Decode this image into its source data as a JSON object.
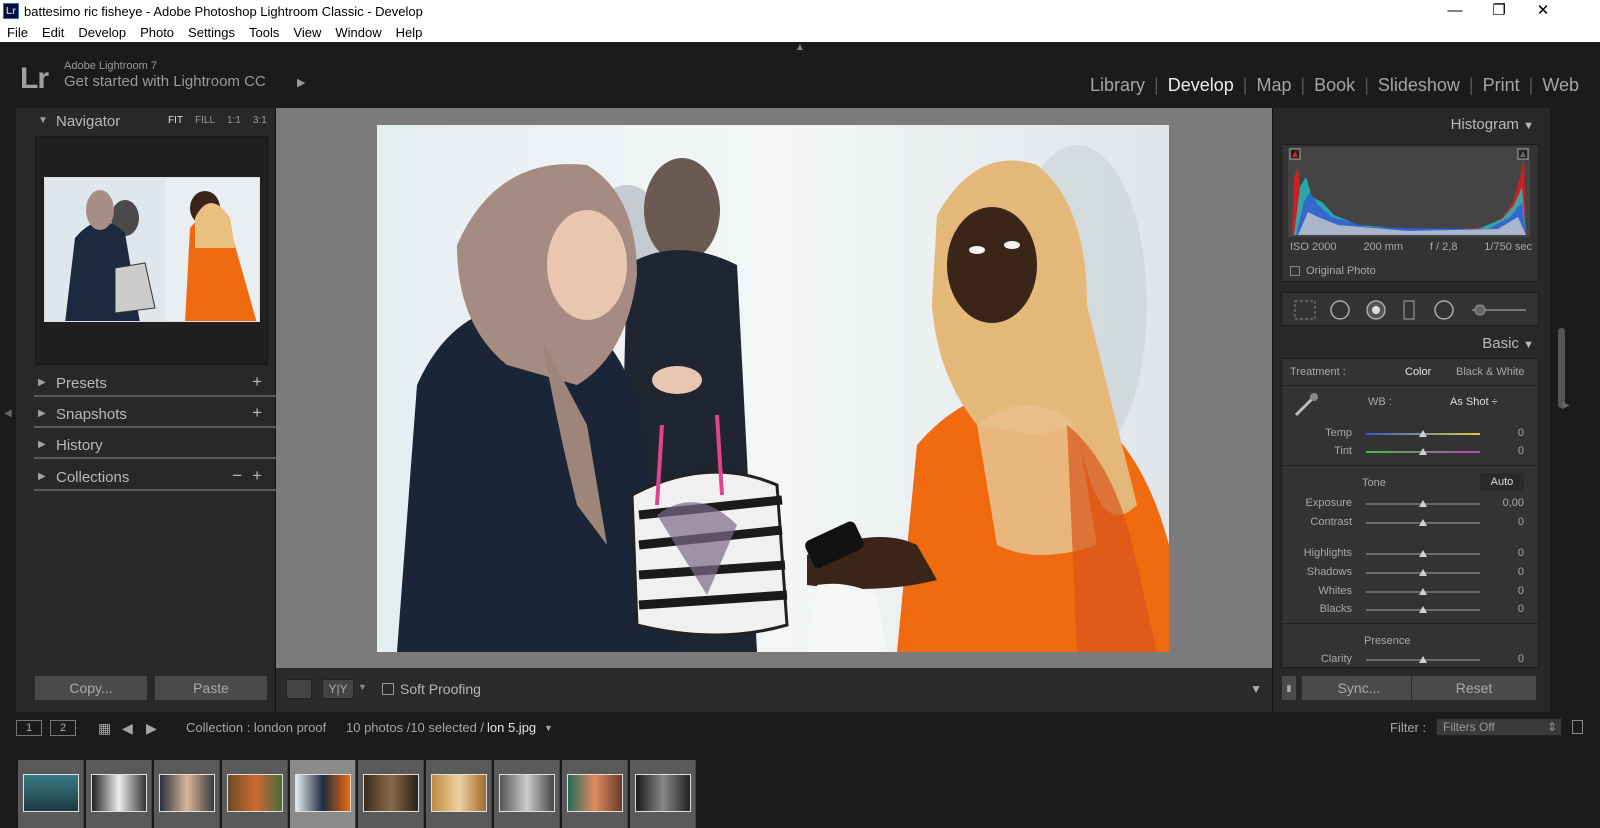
{
  "window": {
    "title": "battesimo ric fisheye - Adobe Photoshop Lightroom Classic - Develop",
    "app_icon": "Lr",
    "minimize": "—",
    "maximize": "❐",
    "close": "✕"
  },
  "menu": [
    "File",
    "Edit",
    "Develop",
    "Photo",
    "Settings",
    "Tools",
    "View",
    "Window",
    "Help"
  ],
  "identity": {
    "logo": "Lr",
    "version": "Adobe Lightroom 7",
    "tagline": "Get started with Lightroom CC",
    "arrow": "▶"
  },
  "modules": [
    "Library",
    "Develop",
    "Map",
    "Book",
    "Slideshow",
    "Print",
    "Web"
  ],
  "active_module": "Develop",
  "left_panel": {
    "navigator": {
      "title": "Navigator",
      "options": [
        "FIT",
        "FILL",
        "1:1",
        "3:1"
      ],
      "active": "FIT"
    },
    "presets": "Presets",
    "snapshots": "Snapshots",
    "history": "History",
    "collections": "Collections",
    "copy_label": "Copy...",
    "paste_label": "Paste"
  },
  "toolbar": {
    "soft_proofing": "Soft Proofing",
    "yy": "Y|Y"
  },
  "right_panel": {
    "histogram_title": "Histogram",
    "iso": "ISO 2000",
    "focal": "200 mm",
    "aperture": "f / 2,8",
    "shutter": "1/750 sec",
    "original_photo": "Original Photo",
    "basic_title": "Basic",
    "treatment_label": "Treatment :",
    "treatment_color": "Color",
    "treatment_bw": "Black & White",
    "wb_label": "WB :",
    "wb_value": "As Shot ÷",
    "tone_label": "Tone",
    "auto_label": "Auto",
    "presence_label": "Presence",
    "sliders": [
      {
        "label": "Temp",
        "value": "0"
      },
      {
        "label": "Tint",
        "value": "0"
      },
      {
        "label": "Exposure",
        "value": "0,00"
      },
      {
        "label": "Contrast",
        "value": "0"
      },
      {
        "label": "Highlights",
        "value": "0"
      },
      {
        "label": "Shadows",
        "value": "0"
      },
      {
        "label": "Whites",
        "value": "0"
      },
      {
        "label": "Blacks",
        "value": "0"
      },
      {
        "label": "Clarity",
        "value": "0"
      }
    ],
    "sync_label": "Sync...",
    "reset_label": "Reset"
  },
  "filmstrip_bar": {
    "monitor1": "1",
    "monitor2": "2",
    "collection": "Collection : london proof",
    "count": "10 photos /10 selected /",
    "filename": "lon 5.jpg",
    "filter_label": "Filter :",
    "filter_value": "Filters Off"
  },
  "colors": {
    "accent": "#e8e8e8",
    "panel": "#282828",
    "background": "#1b1b1b"
  }
}
